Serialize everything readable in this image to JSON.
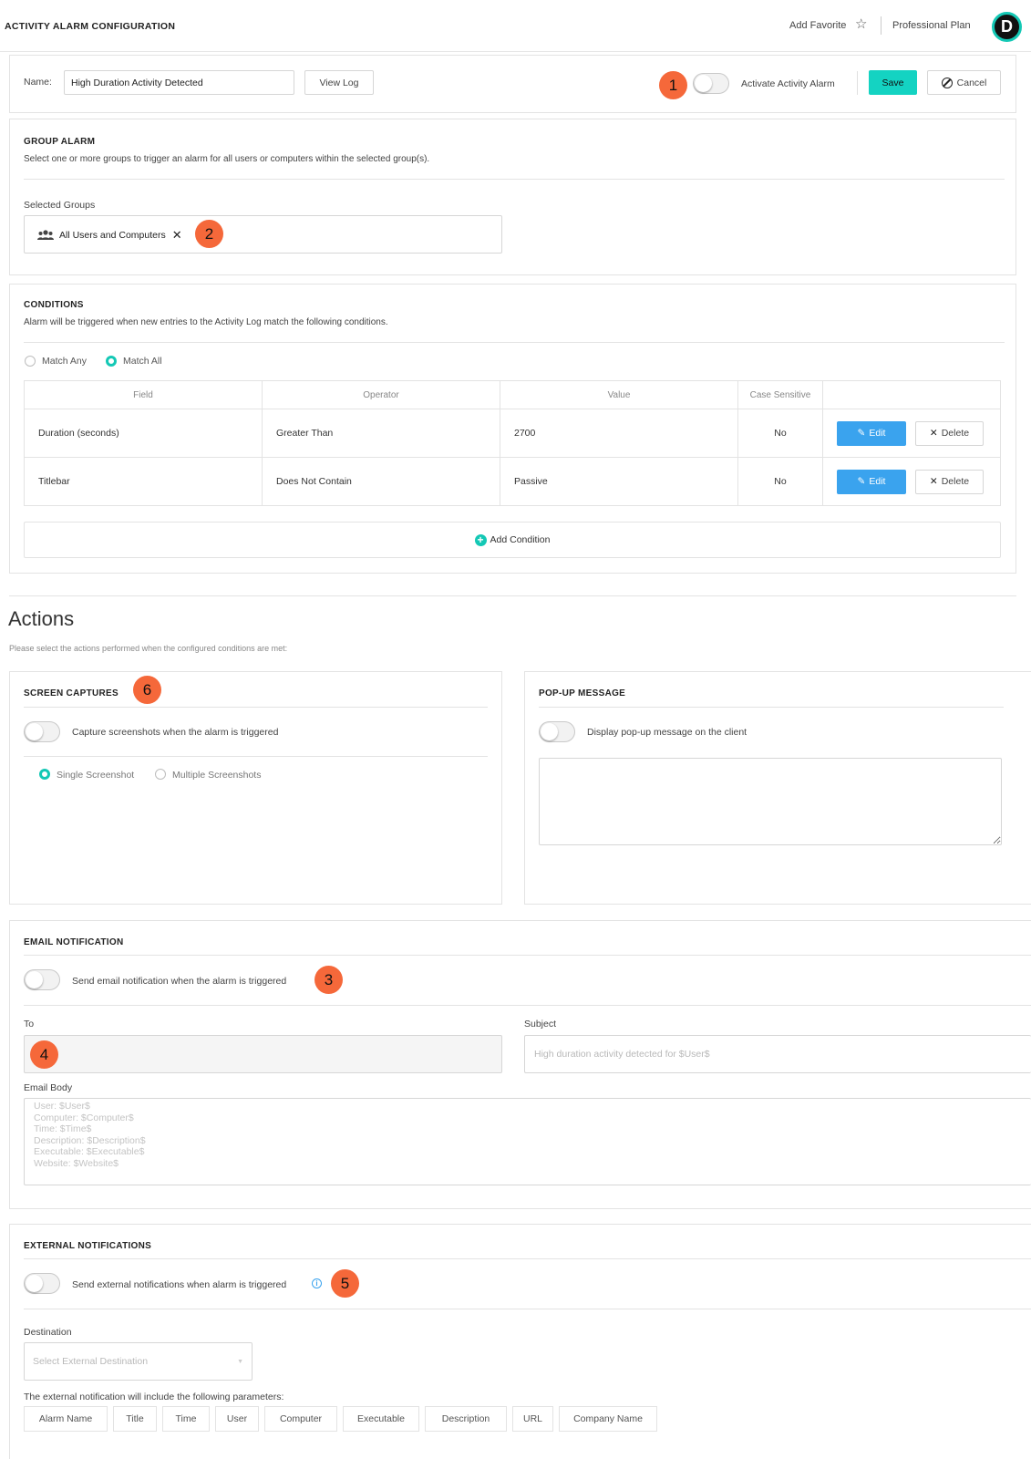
{
  "header": {
    "title": "ACTIVITY ALARM CONFIGURATION",
    "add_favorite": "Add Favorite",
    "plan": "Professional Plan",
    "avatar_letter": "D"
  },
  "alarm": {
    "name_label": "Name:",
    "name_value": "High Duration Activity Detected",
    "view_log": "View Log",
    "activate_label": "Activate Activity Alarm",
    "save": "Save",
    "cancel": "Cancel"
  },
  "group_alarm": {
    "title": "GROUP ALARM",
    "description": "Select one or more groups to trigger an alarm for all users or computers within the selected group(s).",
    "selected_label": "Selected Groups",
    "chip": "All Users and Computers"
  },
  "conditions": {
    "title": "CONDITIONS",
    "description": "Alarm will be triggered when new entries to the Activity Log match the following conditions.",
    "match_any": "Match Any",
    "match_all": "Match All",
    "columns": [
      "Field",
      "Operator",
      "Value",
      "Case Sensitive"
    ],
    "rows": [
      {
        "field": "Duration (seconds)",
        "operator": "Greater Than",
        "value": "2700",
        "case": "No",
        "edit": "Edit",
        "delete": "Delete"
      },
      {
        "field": "Titlebar",
        "operator": "Does Not Contain",
        "value": "Passive",
        "case": "No",
        "edit": "Edit",
        "delete": "Delete"
      }
    ],
    "add_condition": "Add Condition"
  },
  "actions": {
    "heading": "Actions",
    "description": "Please select the actions performed when the configured conditions are met:"
  },
  "screen_captures": {
    "title": "SCREEN CAPTURES",
    "toggle_label": "Capture screenshots when the alarm is triggered",
    "single": "Single Screenshot",
    "multiple": "Multiple Screenshots"
  },
  "popup": {
    "title": "POP-UP MESSAGE",
    "toggle_label": "Display pop-up message on the client"
  },
  "email": {
    "title": "EMAIL NOTIFICATION",
    "toggle_label": "Send email notification when the alarm is triggered",
    "to_label": "To",
    "subject_label": "Subject",
    "subject_placeholder": "High duration activity detected for $User$",
    "body_label": "Email Body",
    "body_lines": [
      "User: $User$",
      "Computer: $Computer$",
      "Time: $Time$",
      "Description: $Description$",
      "Executable: $Executable$",
      "Website: $Website$"
    ]
  },
  "external": {
    "title": "EXTERNAL NOTIFICATIONS",
    "toggle_label": "Send external notifications when alarm is triggered",
    "destination_label": "Destination",
    "destination_placeholder": "Select External Destination",
    "params_label": "The external notification will include the following parameters:",
    "params": [
      "Alarm Name",
      "Title",
      "Time",
      "User",
      "Computer",
      "Executable",
      "Description",
      "URL",
      "Company Name"
    ]
  },
  "badges": [
    "1",
    "2",
    "3",
    "4",
    "5",
    "6"
  ],
  "colors": {
    "accent": "#14d3c2",
    "edit": "#3aa3ee",
    "badge": "#f5683a"
  }
}
